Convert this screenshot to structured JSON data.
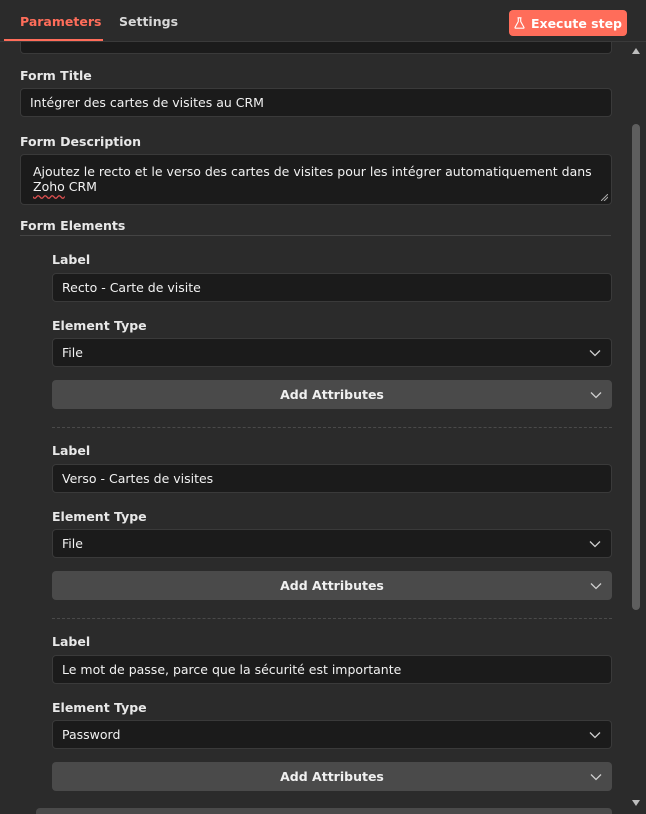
{
  "tabs": {
    "parameters": "Parameters",
    "settings": "Settings"
  },
  "execute_button": {
    "label": "Execute step",
    "icon": "flask-icon"
  },
  "form_title": {
    "label": "Form Title",
    "value": "Intégrer des cartes de visites au CRM"
  },
  "form_description": {
    "label": "Form Description",
    "value_prefix": "Ajoutez le recto et le verso des cartes de visites pour les intégrer automatiquement dans ",
    "value_misspelled": "Zoho",
    "value_suffix": " CRM"
  },
  "form_elements": {
    "label": "Form Elements",
    "items": [
      {
        "label_caption": "Label",
        "label_value": "Recto - Carte de visite",
        "type_caption": "Element Type",
        "type_value": "File",
        "attributes_button": "Add Attributes"
      },
      {
        "label_caption": "Label",
        "label_value": "Verso - Cartes de visites",
        "type_caption": "Element Type",
        "type_value": "File",
        "attributes_button": "Add Attributes"
      },
      {
        "label_caption": "Label",
        "label_value": "Le mot de passe, parce que la sécurité est importante",
        "type_caption": "Element Type",
        "type_value": "Password",
        "attributes_button": "Add Attributes"
      }
    ]
  },
  "colors": {
    "accent": "#ff6d5a",
    "background": "#2b2b2b",
    "input_bg": "#1b1b1b",
    "button_bg": "#4a4a4a"
  }
}
